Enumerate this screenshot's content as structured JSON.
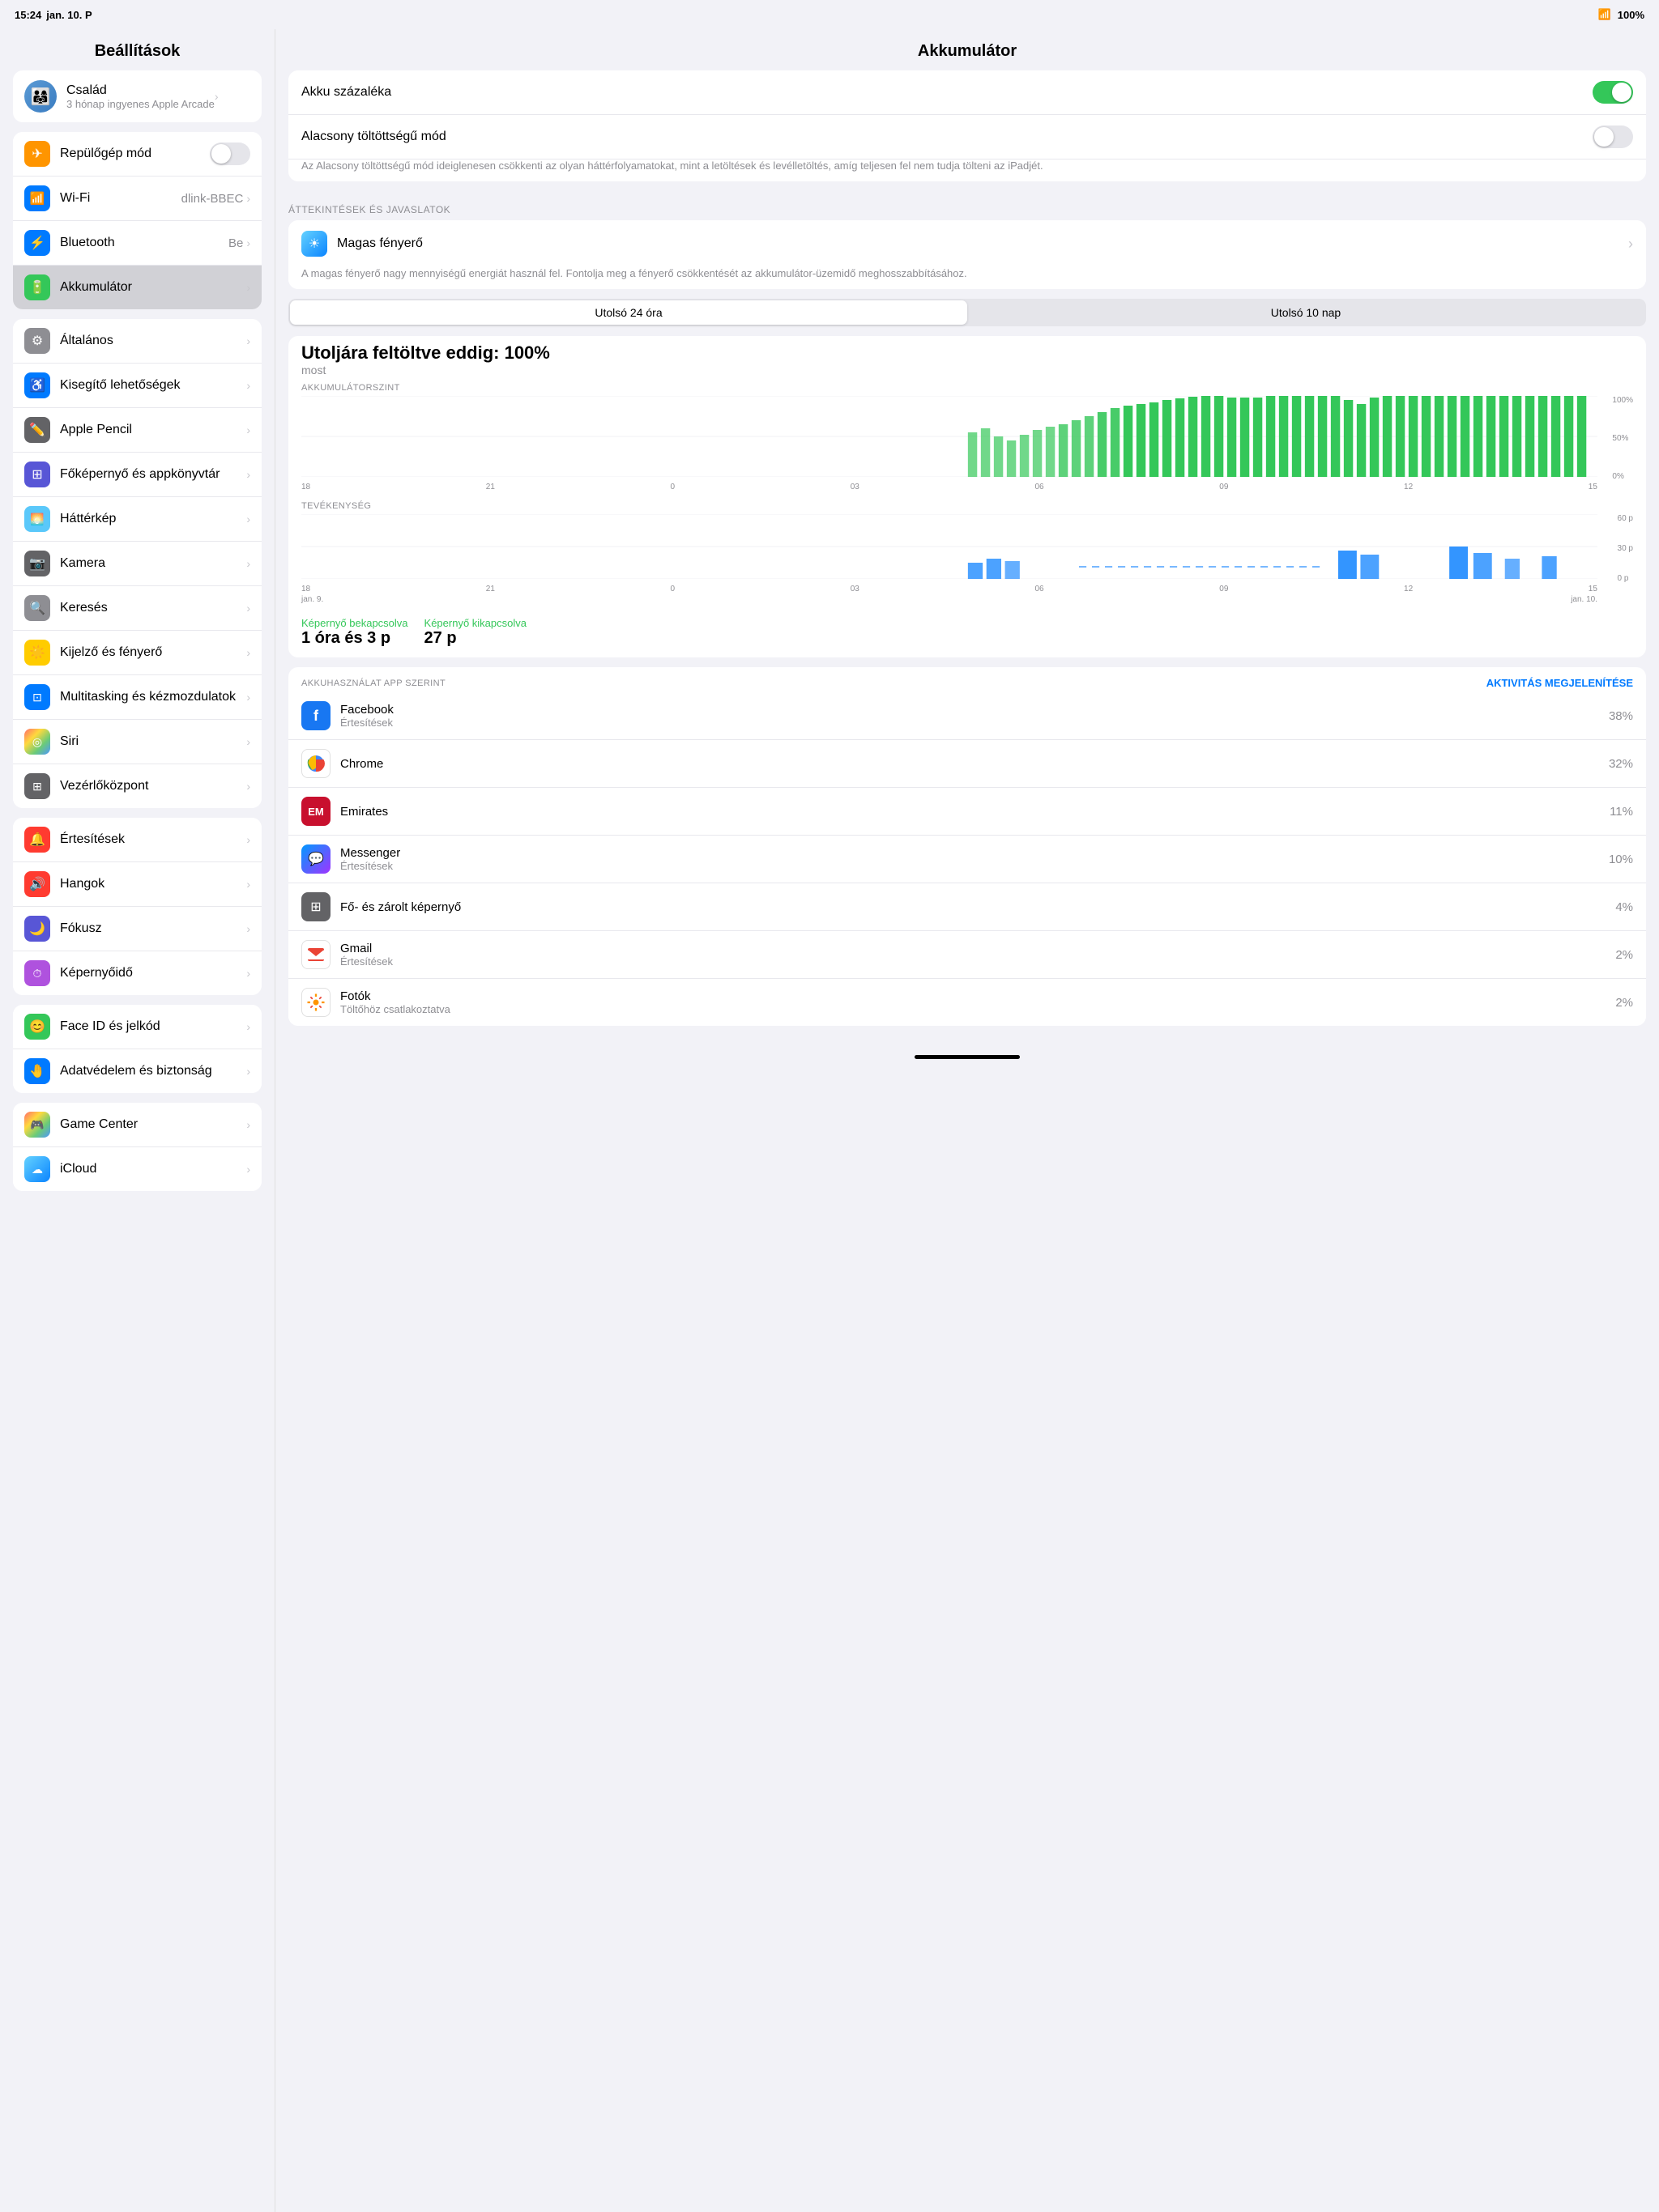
{
  "statusBar": {
    "time": "15:24",
    "date": "jan. 10. P",
    "wifi": true,
    "battery": "100%"
  },
  "sidebar": {
    "title": "Beállítások",
    "family": {
      "name": "Család",
      "subtitle": "3 hónap ingyenes Apple Arcade"
    },
    "groups": [
      {
        "id": "group1",
        "items": [
          {
            "id": "airplane",
            "label": "Repülőgép mód",
            "icon": "✈",
            "iconBg": "ic-orange",
            "hasToggle": true,
            "toggleOn": false
          },
          {
            "id": "wifi",
            "label": "Wi-Fi",
            "icon": "📶",
            "iconBg": "ic-blue",
            "value": "dlink-BBEC",
            "hasChevron": true
          },
          {
            "id": "bluetooth",
            "label": "Bluetooth",
            "icon": "⚙",
            "iconBg": "ic-blue",
            "value": "Be",
            "hasChevron": true
          },
          {
            "id": "battery",
            "label": "Akkumulátor",
            "icon": "🔋",
            "iconBg": "ic-green",
            "hasChevron": true,
            "active": true
          }
        ]
      },
      {
        "id": "group2",
        "items": [
          {
            "id": "general",
            "label": "Általános",
            "icon": "⚙",
            "iconBg": "ic-gray",
            "hasChevron": true
          },
          {
            "id": "accessibility",
            "label": "Kisegítő lehetőségek",
            "icon": "♿",
            "iconBg": "ic-blue",
            "hasChevron": true
          },
          {
            "id": "applepencil",
            "label": "Apple Pencil",
            "icon": "✏",
            "iconBg": "ic-darkgray",
            "hasChevron": true
          },
          {
            "id": "homescreen",
            "label": "Főképernyő és appkönyvtár",
            "icon": "⊞",
            "iconBg": "ic-indigo",
            "hasChevron": true
          },
          {
            "id": "wallpaper",
            "label": "Háttérkép",
            "icon": "🌅",
            "iconBg": "ic-teal",
            "hasChevron": true
          },
          {
            "id": "camera",
            "label": "Kamera",
            "icon": "📷",
            "iconBg": "ic-darkgray",
            "hasChevron": true
          },
          {
            "id": "search",
            "label": "Keresés",
            "icon": "🔍",
            "iconBg": "ic-darkgray",
            "hasChevron": true
          },
          {
            "id": "display",
            "label": "Kijelző és fényerő",
            "icon": "☀",
            "iconBg": "ic-yellow",
            "hasChevron": true
          },
          {
            "id": "multitask",
            "label": "Multitasking és kézmozdulatok",
            "icon": "⊡",
            "iconBg": "ic-blue",
            "hasChevron": true
          },
          {
            "id": "siri",
            "label": "Siri",
            "icon": "◎",
            "iconBg": "ic-multicolor",
            "hasChevron": true
          },
          {
            "id": "controlcenter",
            "label": "Vezérlőközpont",
            "icon": "⊞",
            "iconBg": "ic-darkgray",
            "hasChevron": true
          }
        ]
      },
      {
        "id": "group3",
        "items": [
          {
            "id": "notifications",
            "label": "Értesítések",
            "icon": "🔔",
            "iconBg": "ic-red",
            "hasChevron": true
          },
          {
            "id": "sounds",
            "label": "Hangok",
            "icon": "🔊",
            "iconBg": "ic-red",
            "hasChevron": true
          },
          {
            "id": "focus",
            "label": "Fókusz",
            "icon": "🌙",
            "iconBg": "ic-indigo",
            "hasChevron": true
          },
          {
            "id": "screentime",
            "label": "Képernyőidő",
            "icon": "⏱",
            "iconBg": "ic-purple",
            "hasChevron": true
          }
        ]
      },
      {
        "id": "group4",
        "items": [
          {
            "id": "faceid",
            "label": "Face ID és jelkód",
            "icon": "😊",
            "iconBg": "ic-green",
            "hasChevron": true
          },
          {
            "id": "privacy",
            "label": "Adatvédelem és biztonság",
            "icon": "🤚",
            "iconBg": "ic-blue",
            "hasChevron": true
          }
        ]
      },
      {
        "id": "group5",
        "items": [
          {
            "id": "gamecenter",
            "label": "Game Center",
            "icon": "🎮",
            "iconBg": "ic-multicolor",
            "hasChevron": true
          },
          {
            "id": "icloud",
            "label": "iCloud",
            "icon": "☁",
            "iconBg": "ic-icloud",
            "hasChevron": true
          }
        ]
      }
    ]
  },
  "main": {
    "title": "Akkumulátor",
    "settings": [
      {
        "id": "battery-pct",
        "label": "Akku százaléka",
        "toggleOn": true
      },
      {
        "id": "low-power",
        "label": "Alacsony töltöttségű mód",
        "toggleOn": false
      }
    ],
    "low_power_desc": "Az Alacsony töltöttségű mód ideiglenesen csökkenti az olyan háttérfolyamatokat, mint a letöltések és levélletöltés, amíg teljesen fel nem tudja tölteni az iPadjét.",
    "section_label": "ÁTTEKINTÉSEK ÉS JAVASLATOK",
    "brightness": {
      "label": "Magas fényerő",
      "desc": "A magas fényerő nagy mennyiségű energiát használ fel. Fontolja meg a fényerő csökkentését az akkumulátor-üzemidő meghosszabbításához."
    },
    "tabs": [
      {
        "id": "last24",
        "label": "Utolsó 24 óra",
        "active": true
      },
      {
        "id": "last10",
        "label": "Utolsó 10 nap"
      }
    ],
    "charge_status": "Utoljára feltöltve eddig: 100%",
    "charge_time": "most",
    "chart_section": "AKKUMULÁTORSZINT",
    "activity_section": "TEVÉKENYSÉG",
    "xLabels": [
      "18",
      "21",
      "0",
      "03",
      "06",
      "09",
      "12",
      "15"
    ],
    "xLabelsActivity": [
      "18",
      "21",
      "0",
      "03",
      "06",
      "09",
      "12",
      "15"
    ],
    "yLabels_battery": [
      "100%",
      "50%",
      "0%"
    ],
    "yLabels_activity": [
      "60 p",
      "30 p",
      "0 p"
    ],
    "xDateLabels": [
      "jan. 9.",
      "",
      "jan. 10."
    ],
    "screen_on": {
      "label": "Képernyő bekapcsolva",
      "value": "1 óra és 3 p"
    },
    "screen_off": {
      "label": "Képernyő kikapcsolva",
      "value": "27 p"
    },
    "app_usage_title": "AKKUHASZNÁLAT APP SZERINT",
    "app_usage_action": "AKTIVITÁS MEGJELENÍTÉSE",
    "apps": [
      {
        "id": "facebook",
        "name": "Facebook",
        "sub": "Értesítések",
        "pct": "38%",
        "color": "#1877F2",
        "icon": "f"
      },
      {
        "id": "chrome",
        "name": "Chrome",
        "sub": "",
        "pct": "32%",
        "color": "#4285F4",
        "icon": "C"
      },
      {
        "id": "emirates",
        "name": "Emirates",
        "sub": "",
        "pct": "11%",
        "color": "#C8102E",
        "icon": "E"
      },
      {
        "id": "messenger",
        "name": "Messenger",
        "sub": "Értesítések",
        "pct": "10%",
        "color": "#0099FF",
        "icon": "M"
      },
      {
        "id": "homescreen",
        "name": "Fő- és zárolt képernyő",
        "sub": "",
        "pct": "4%",
        "color": "#636366",
        "icon": "⊞"
      },
      {
        "id": "gmail",
        "name": "Gmail",
        "sub": "Értesítések",
        "pct": "2%",
        "color": "#EA4335",
        "icon": "G"
      },
      {
        "id": "photos",
        "name": "Fotók",
        "sub": "Töltőhöz csatlakoztatva",
        "pct": "2%",
        "color": "#FF9500",
        "icon": "🌸"
      }
    ]
  }
}
